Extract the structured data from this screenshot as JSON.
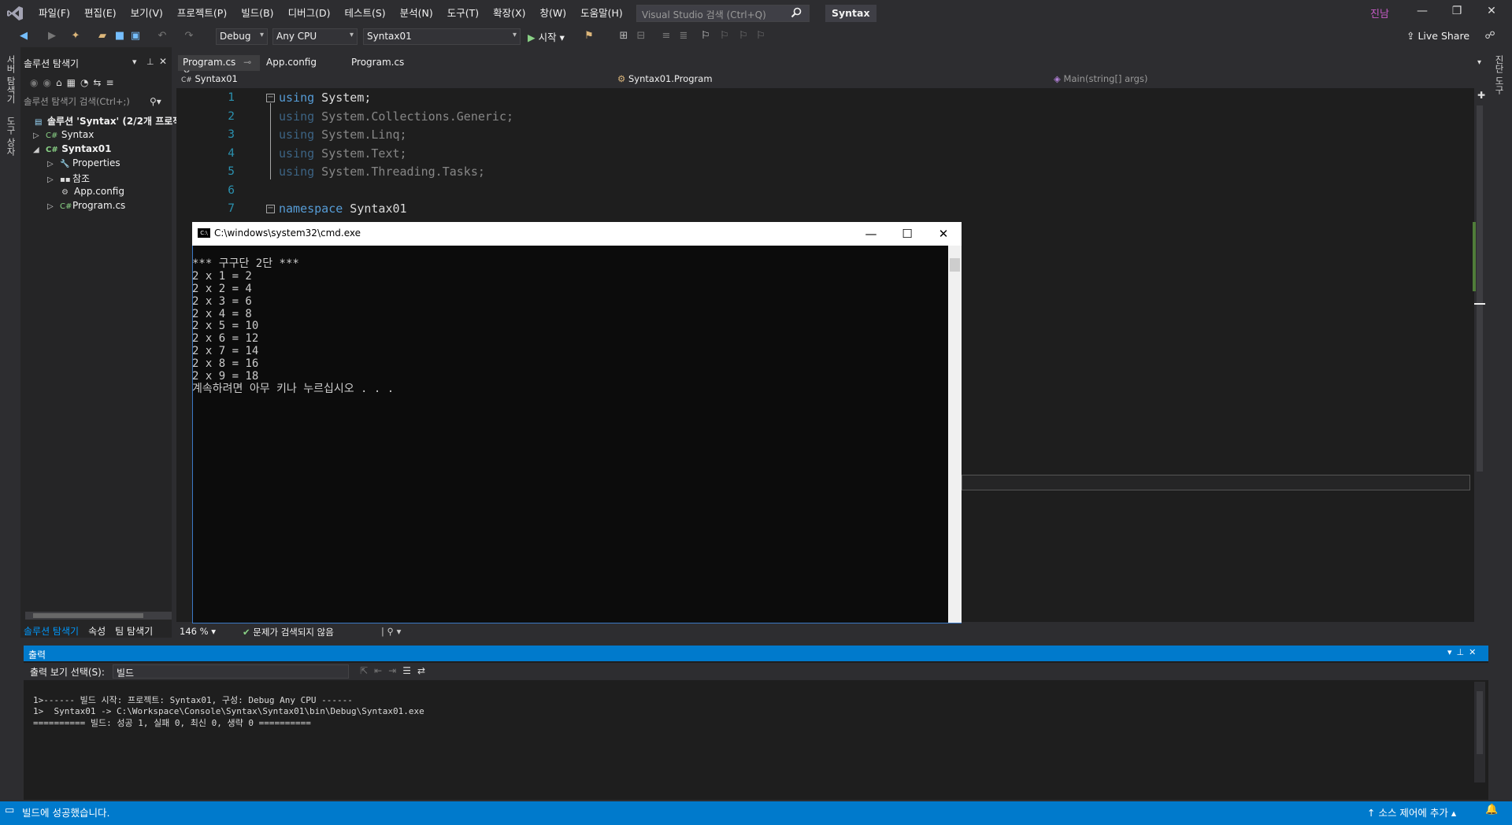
{
  "titlebar": {
    "menu": [
      "파일(F)",
      "편집(E)",
      "보기(V)",
      "프로젝트(P)",
      "빌드(B)",
      "디버그(D)",
      "테스트(S)",
      "분석(N)",
      "도구(T)",
      "확장(X)",
      "창(W)",
      "도움말(H)"
    ],
    "search_placeholder": "Visual Studio 검색 (Ctrl+Q)",
    "solution_name": "Syntax",
    "user": "진남"
  },
  "toolbar": {
    "config": "Debug",
    "platform": "Any CPU",
    "project": "Syntax01",
    "start_label": "시작",
    "live_share": "Live Share"
  },
  "left_strip": [
    "서버 탐색기",
    "도구 상자"
  ],
  "right_strip": [
    "진단 도구"
  ],
  "solution_explorer": {
    "title": "솔루션 탐색기",
    "search_placeholder": "솔루션 탐색기 검색(Ctrl+;)",
    "tree": [
      {
        "label": "솔루션 'Syntax' (2/2개 프로젝",
        "bold": true
      },
      {
        "label": "Syntax"
      },
      {
        "label": "Syntax01"
      },
      {
        "label": "Properties"
      },
      {
        "label": "참조"
      },
      {
        "label": "App.config"
      },
      {
        "label": "Program.cs"
      }
    ],
    "bottom_tabs": [
      "솔루션 탐색기",
      "속성",
      "팀 탐색기"
    ]
  },
  "editor": {
    "tabs": [
      "Program.cs",
      "App.config",
      "Program.cs"
    ],
    "nav": [
      "Syntax01",
      "Syntax01.Program",
      "Main(string[] args)"
    ],
    "line_numbers": [
      "1",
      "2",
      "3",
      "4",
      "5",
      "6",
      "7"
    ],
    "zoom": "146 %",
    "issues": "문제가 검색되지 않음"
  },
  "cmd": {
    "title": "C:\\windows\\system32\\cmd.exe",
    "lines": [
      "*** 구구단 2단 ***",
      "2 x 1 = 2",
      "2 x 2 = 4",
      "2 x 3 = 6",
      "2 x 4 = 8",
      "2 x 5 = 10",
      "2 x 6 = 12",
      "2 x 7 = 14",
      "2 x 8 = 16",
      "2 x 9 = 18",
      "계속하려면 아무 키나 누르십시오 . . ."
    ]
  },
  "output": {
    "title": "출력",
    "source_label": "출력 보기 선택(S):",
    "source_value": "빌드",
    "lines": [
      "1>------ 빌드 시작: 프로젝트: Syntax01, 구성: Debug Any CPU ------",
      "1>  Syntax01 -> C:\\Workspace\\Console\\Syntax\\Syntax01\\bin\\Debug\\Syntax01.exe",
      "========== 빌드: 성공 1, 실패 0, 최신 0, 생략 0 =========="
    ]
  },
  "status": {
    "message": "빌드에 성공했습니다.",
    "source_control": "소스 제어에 추가"
  }
}
